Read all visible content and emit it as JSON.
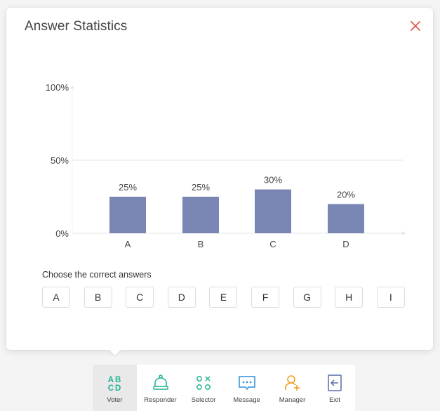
{
  "dialog": {
    "title": "Answer Statistics",
    "close_icon": "close-icon",
    "close_color": "#e05a4f"
  },
  "chart_data": {
    "type": "bar",
    "title": "",
    "xlabel": "",
    "ylabel": "",
    "categories": [
      "A",
      "B",
      "C",
      "D"
    ],
    "values": [
      25,
      25,
      30,
      20
    ],
    "value_labels": [
      "25%",
      "25%",
      "30%",
      "20%"
    ],
    "y_ticks": [
      "100%",
      "50%",
      "0%"
    ],
    "ylim": [
      0,
      100
    ],
    "grid": true,
    "bar_color": "#7986b3"
  },
  "answers": {
    "label": "Choose the correct answers",
    "options": [
      "A",
      "B",
      "C",
      "D",
      "E",
      "F",
      "G",
      "H",
      "I"
    ]
  },
  "toolbar": {
    "accent_green": "#1fb496",
    "accent_blue": "#2b8fd6",
    "accent_orange": "#f0a21f",
    "accent_slate": "#5a6aa8",
    "items": [
      {
        "label": "Voter",
        "icon": "voter-icon",
        "active": true
      },
      {
        "label": "Responder",
        "icon": "bell-icon",
        "active": false
      },
      {
        "label": "Selector",
        "icon": "selector-icon",
        "active": false
      },
      {
        "label": "Message",
        "icon": "message-icon",
        "active": false
      },
      {
        "label": "Manager",
        "icon": "add-user-icon",
        "active": false
      },
      {
        "label": "Exit",
        "icon": "exit-icon",
        "active": false
      }
    ]
  }
}
